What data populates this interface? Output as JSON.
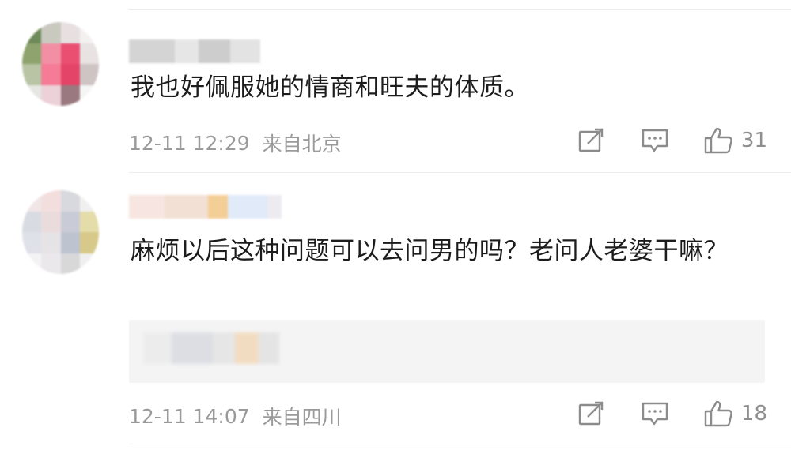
{
  "comments": [
    {
      "text": "我也好佩服她的情商和旺夫的体质。",
      "timestamp": "12-11 12:29",
      "location": "来自北京",
      "share_icon": "share-icon",
      "reply_icon": "comment-icon",
      "like_icon": "thumbs-up-icon",
      "likes": "31"
    },
    {
      "text": "麻烦以后这种问题可以去问男的吗？老问人老婆干嘛？",
      "timestamp": "12-11 14:07",
      "location": "来自四川",
      "share_icon": "share-icon",
      "reply_icon": "comment-icon",
      "like_icon": "thumbs-up-icon",
      "likes": "18"
    }
  ]
}
